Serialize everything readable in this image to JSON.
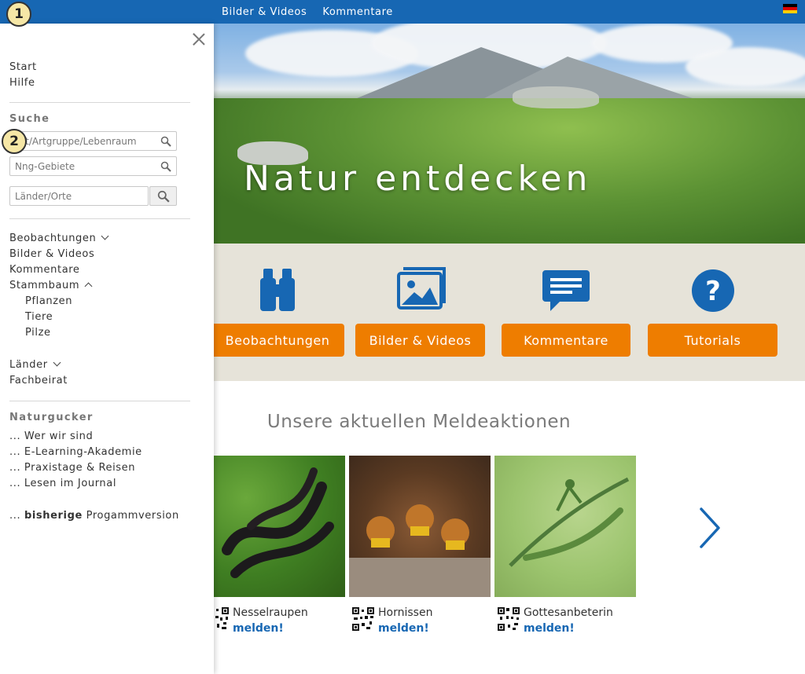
{
  "topnav": {
    "items": [
      "Bilder & Videos",
      "Kommentare"
    ]
  },
  "flag": {
    "colors": [
      "#000000",
      "#dd0000",
      "#ffce00"
    ]
  },
  "hero": {
    "title": "Natur entdecken"
  },
  "features": [
    {
      "label": "Beobachtungen",
      "icon": "binoculars-icon"
    },
    {
      "label": "Bilder & Videos",
      "icon": "image-gallery-icon"
    },
    {
      "label": "Kommentare",
      "icon": "speech-bubble-icon"
    },
    {
      "label": "Tutorials",
      "icon": "question-circle-icon"
    }
  ],
  "campaigns": {
    "title": "Unsere aktuellen Meldeaktionen",
    "cards": [
      {
        "name": "Nesselraupen",
        "action": "melden!"
      },
      {
        "name": "Hornissen",
        "action": "melden!"
      },
      {
        "name": "Gottesanbeterin",
        "action": "melden!"
      }
    ]
  },
  "sidebar": {
    "top_links": [
      "Start",
      "Hilfe"
    ],
    "search": {
      "heading": "Suche",
      "species_placeholder": "Art/Artgruppe/Lebenraum",
      "areas_placeholder": "Nng-Gebiete",
      "places_placeholder": "Länder/Orte"
    },
    "nav": {
      "beobachtungen": "Beobachtungen",
      "bilder": "Bilder & Videos",
      "kommentare": "Kommentare",
      "stammbaum": "Stammbaum",
      "pflanzen": "Pflanzen",
      "tiere": "Tiere",
      "pilze": "Pilze",
      "laender": "Länder",
      "fachbeirat": "Fachbeirat"
    },
    "naturgucker": {
      "heading": "Naturgucker",
      "links": [
        "... Wer wir sind",
        "... E-Learning-Akademie",
        "... Praxistage & Reisen",
        "... Lesen im Journal"
      ],
      "legacy_prefix": "...",
      "legacy_bold": "bisherige",
      "legacy_rest": "Progammversion"
    }
  },
  "markers": [
    "1",
    "2"
  ],
  "colors": {
    "brand_blue": "#1767b3",
    "accent_orange": "#ee7d00",
    "band_bg": "#e6e3d9"
  }
}
